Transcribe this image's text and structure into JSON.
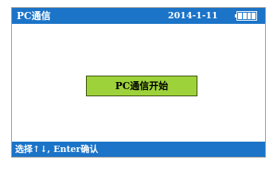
{
  "header": {
    "title": "PC通信",
    "date": "2014-1-11",
    "battery_icon": "battery-full-icon",
    "battery_level": 1.0
  },
  "main": {
    "status_message": "PC通信开始"
  },
  "footer": {
    "hint": "选择↑↓, Enter确认"
  },
  "colors": {
    "bar_blue": "#1b74c8",
    "status_green": "#9ed23a"
  }
}
